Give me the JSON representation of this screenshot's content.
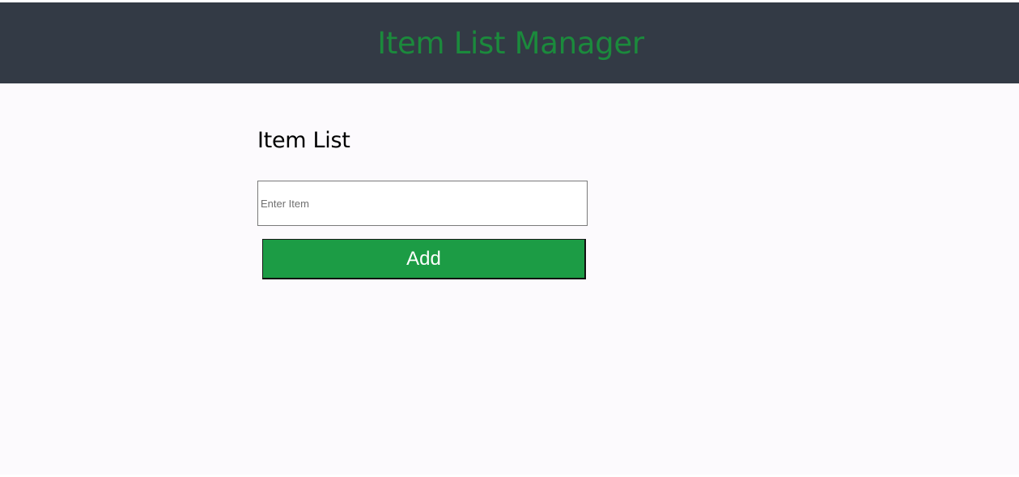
{
  "header": {
    "title": "Item List Manager"
  },
  "main": {
    "section_title": "Item List",
    "item_input": {
      "value": "",
      "placeholder": "Enter Item"
    },
    "add_button_label": "Add"
  },
  "colors": {
    "header_background": "#333a45",
    "header_title": "#1b8a3c",
    "page_background": "#fcfafd",
    "add_button_background": "#1c9c45",
    "add_button_text": "#ffffff"
  }
}
